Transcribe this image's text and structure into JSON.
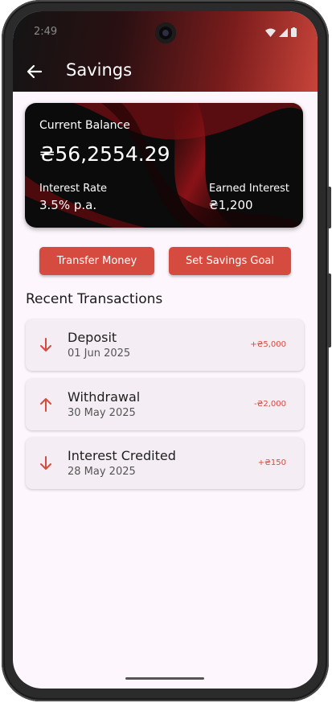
{
  "status": {
    "time": "2:49"
  },
  "header": {
    "title": "Savings"
  },
  "balance_card": {
    "label": "Current Balance",
    "amount": "₴56,2554.29",
    "interest_rate_label": "Interest Rate",
    "interest_rate_value": "3.5% p.a.",
    "earned_interest_label": "Earned Interest",
    "earned_interest_value": "₴1,200"
  },
  "actions": {
    "transfer_label": "Transfer Money",
    "goal_label": "Set Savings Goal"
  },
  "recent": {
    "heading": "Recent Transactions",
    "items": [
      {
        "name": "Deposit",
        "date": "01 Jun 2025",
        "amount": "+₴5,000",
        "direction": "down"
      },
      {
        "name": "Withdrawal",
        "date": "30 May 2025",
        "amount": "-₴2,000",
        "direction": "up"
      },
      {
        "name": "Interest Credited",
        "date": "28 May 2025",
        "amount": "+₴150",
        "direction": "down"
      }
    ]
  },
  "colors": {
    "accent": "#d64b3f",
    "card_bg": "#0b0b0b",
    "screen_bg": "#fdf7fd"
  }
}
